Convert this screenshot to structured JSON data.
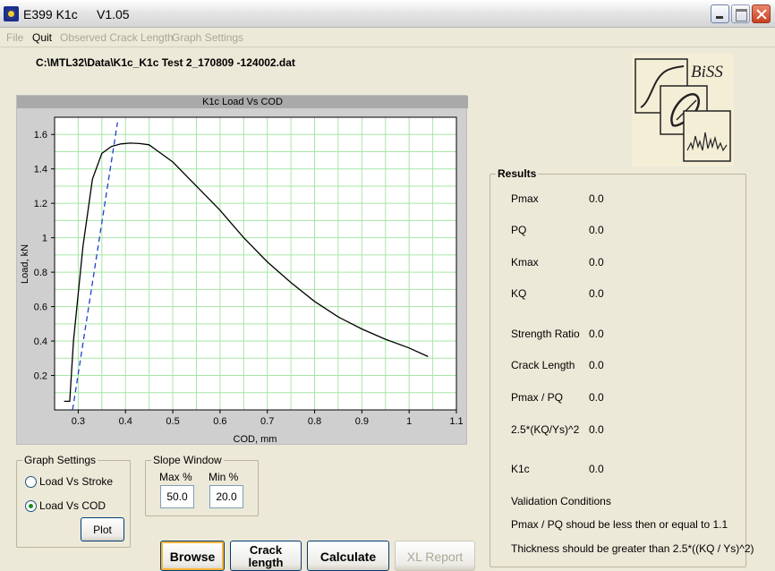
{
  "window": {
    "title": "E399 K1c",
    "version": "V1.05"
  },
  "menu": {
    "items": [
      {
        "label": "File",
        "enabled": false
      },
      {
        "label": "Quit",
        "enabled": true
      },
      {
        "label": "Observed Crack Length",
        "enabled": false
      },
      {
        "label": "Graph Settings",
        "enabled": false
      }
    ]
  },
  "file_path": "C:\\MTL32\\Data\\K1c_K1c Test 2_170809 -124002.dat",
  "logo": {
    "text": "BiSS"
  },
  "chart_data": {
    "type": "line",
    "title": "K1c Load Vs COD",
    "xlabel": "COD, mm",
    "ylabel": "Load, kN",
    "xlim": [
      0.25,
      1.1
    ],
    "ylim": [
      0,
      1.7
    ],
    "xticks": [
      "0.3",
      "0.4",
      "0.5",
      "0.6",
      "0.7",
      "0.8",
      "0.9",
      "1",
      "1.1"
    ],
    "yticks": [
      "0.2",
      "0.4",
      "0.6",
      "0.8",
      "1",
      "1.2",
      "1.4",
      "1.6"
    ],
    "grid": true,
    "series": [
      {
        "style": "solid",
        "color": "#000000",
        "x": [
          0.27,
          0.282,
          0.29,
          0.31,
          0.33,
          0.35,
          0.37,
          0.39,
          0.41,
          0.43,
          0.45,
          0.47,
          0.5,
          0.55,
          0.6,
          0.65,
          0.7,
          0.75,
          0.8,
          0.85,
          0.9,
          0.95,
          1.0,
          1.04
        ],
        "y": [
          0.05,
          0.05,
          0.4,
          0.95,
          1.34,
          1.49,
          1.53,
          1.545,
          1.55,
          1.547,
          1.54,
          1.5,
          1.44,
          1.3,
          1.16,
          1.0,
          0.86,
          0.74,
          0.63,
          0.54,
          0.47,
          0.41,
          0.36,
          0.31
        ]
      },
      {
        "style": "dashed",
        "color": "#1f3fd0",
        "x": [
          0.288,
          0.383
        ],
        "y": [
          0.0,
          1.67
        ]
      }
    ]
  },
  "graph_settings": {
    "legend": "Graph Settings",
    "option_stroke": "Load Vs Stroke",
    "option_cod": "Load Vs COD",
    "selected": "Load Vs COD",
    "plot_label": "Plot"
  },
  "slope_window": {
    "legend": "Slope Window",
    "max_label": "Max %",
    "min_label": "Min %",
    "max_value": "50.0",
    "min_value": "20.0"
  },
  "buttons": {
    "browse": "Browse",
    "crack_line1": "Crack",
    "crack_line2": "length",
    "calculate": "Calculate",
    "xl_report": "XL Report"
  },
  "results": {
    "legend": "Results",
    "rows": [
      {
        "label": "Pmax",
        "value": "0.0"
      },
      {
        "label": "PQ",
        "value": "0.0"
      },
      {
        "label": "Kmax",
        "value": "0.0"
      },
      {
        "label": "KQ",
        "value": "0.0"
      },
      {
        "label": "Strength Ratio",
        "value": "0.0"
      },
      {
        "label": "Crack Length",
        "value": "0.0"
      },
      {
        "label": "Pmax / PQ",
        "value": "0.0"
      },
      {
        "label": "2.5*(KQ/Ys)^2",
        "value": "0.0"
      },
      {
        "label": "K1c",
        "value": "0.0"
      }
    ],
    "validation_title": "Validation Conditions",
    "validation_1": "Pmax / PQ shoud be less then or equal to 1.1",
    "validation_2": "Thickness should be greater than 2.5*((KQ / Ys)^2)"
  }
}
